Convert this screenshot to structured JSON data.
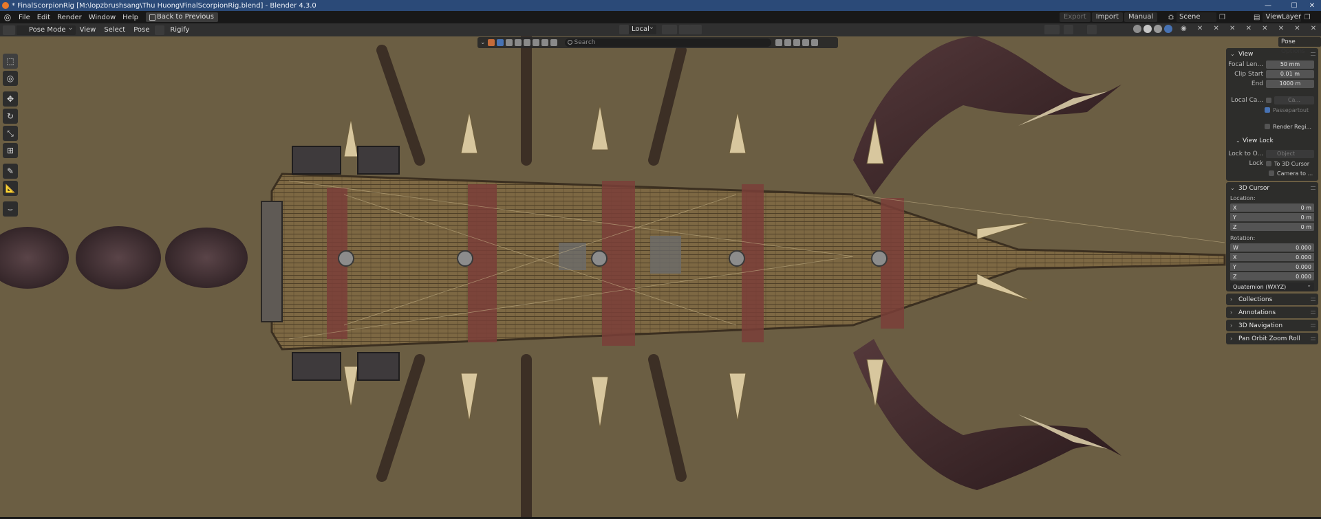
{
  "window": {
    "title": "* FinalScorpionRig [M:\\lopzbrushsang\\Thu Huong\\FinalScorpionRig.blend] - Blender 4.3.0",
    "minimize": "—",
    "maximize": "☐",
    "close": "✕"
  },
  "menubar": {
    "items": [
      "File",
      "Edit",
      "Render",
      "Window",
      "Help"
    ],
    "back_button": "Back to Previous",
    "export_label": "Export",
    "import_label": "Import",
    "manual_label": "Manual",
    "scene_name": "Scene",
    "viewlayer_name": "ViewLayer"
  },
  "header": {
    "mode": "Pose Mode",
    "menus": [
      "View",
      "Select",
      "Pose"
    ],
    "rig_label": "Rigify",
    "orientation": "Local"
  },
  "viewport": {
    "search_placeholder": "Search",
    "background_color": "#6b5e43"
  },
  "toolbar": {
    "tools": [
      "select-box-icon",
      "cursor-icon",
      "move-icon",
      "rotate-icon",
      "scale-icon",
      "transform-icon",
      "annotate-icon",
      "measure-icon",
      "relax-pose-icon"
    ]
  },
  "sidebar": {
    "pose_options_tab": "Pose Options",
    "view_panel": {
      "title": "View",
      "focal_length_label": "Focal Len...",
      "focal_length": "50 mm",
      "clip_start_label": "Clip Start",
      "clip_start": "0.01 m",
      "clip_end_label": "End",
      "clip_end": "1000 m",
      "local_camera_label": "Local Ca...",
      "local_camera_value": "Ca...",
      "passepartout_label": "Passepartout",
      "render_region_label": "Render Regi...",
      "view_lock_title": "View Lock",
      "lock_to_object_label": "Lock to O...",
      "lock_to_object_value": "Object",
      "lock_label": "Lock",
      "to_3d_cursor_label": "To 3D Cursor",
      "camera_to_view_label": "Camera to ..."
    },
    "cursor_panel": {
      "title": "3D Cursor",
      "location_label": "Location:",
      "loc_x_label": "X",
      "loc_x": "0 m",
      "loc_y_label": "Y",
      "loc_y": "0 m",
      "loc_z_label": "Z",
      "loc_z": "0 m",
      "rotation_label": "Rotation:",
      "rot_w_label": "W",
      "rot_w": "0.000",
      "rot_x_label": "X",
      "rot_x": "0.000",
      "rot_y_label": "Y",
      "rot_y": "0.000",
      "rot_z_label": "Z",
      "rot_z": "0.000",
      "rotation_mode": "Quaternion (WXYZ)"
    },
    "collapsed_panels": [
      "Collections",
      "Annotations",
      "3D Navigation",
      "Pan Orbit Zoom Roll"
    ]
  }
}
